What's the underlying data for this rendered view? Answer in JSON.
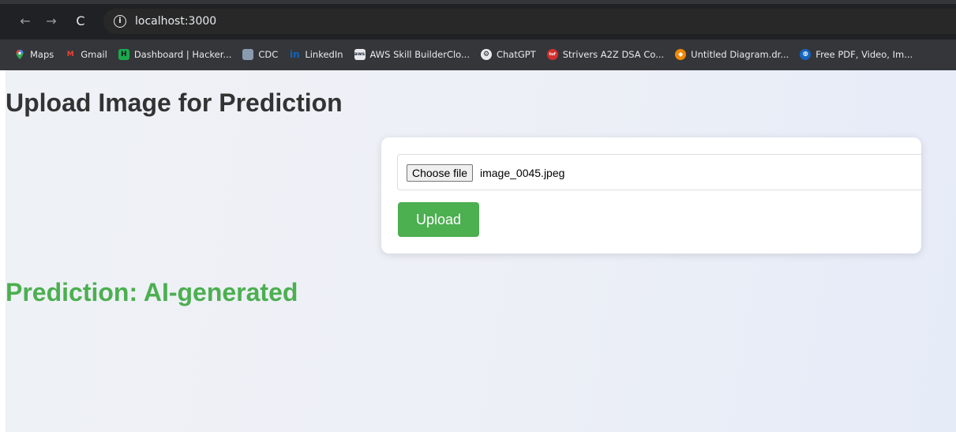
{
  "browser": {
    "nav": {
      "back_icon": "←",
      "forward_icon": "→",
      "reload_icon": "C",
      "info_icon": "i"
    },
    "url": "localhost:3000",
    "bookmarks": [
      {
        "label": "Maps",
        "icon": "maps-icon",
        "color": "#ea4335",
        "glyph": ""
      },
      {
        "label": "Gmail",
        "icon": "gmail-icon",
        "color": "#ea4335",
        "glyph": "M"
      },
      {
        "label": "Dashboard | Hacker...",
        "icon": "hackerrank-icon",
        "color": "#1ba94c",
        "glyph": "H"
      },
      {
        "label": "CDC",
        "icon": "cdc-icon",
        "color": "#8a9bb0",
        "glyph": ""
      },
      {
        "label": "LinkedIn",
        "icon": "linkedin-icon",
        "color": "#0a66c2",
        "glyph": "in"
      },
      {
        "label": "AWS Skill BuilderClo...",
        "icon": "aws-icon",
        "color": "#232f3e",
        "glyph": "aws"
      },
      {
        "label": "ChatGPT",
        "icon": "chatgpt-icon",
        "color": "#555555",
        "glyph": "⚙"
      },
      {
        "label": "Strivers A2Z DSA Co...",
        "icon": "takeuforward-icon",
        "color": "#d32f2f",
        "glyph": "tuf"
      },
      {
        "label": "Untitled Diagram.dr...",
        "icon": "drawio-icon",
        "color": "#f08705",
        "glyph": "◆"
      },
      {
        "label": "Free PDF, Video, Im...",
        "icon": "converter-icon",
        "color": "#1565c0",
        "glyph": "⊕"
      }
    ]
  },
  "page": {
    "title": "Upload Image for Prediction",
    "form": {
      "choose_file_label": "Choose file",
      "file_name": "image_0045.jpeg",
      "upload_label": "Upload"
    },
    "prediction": "Prediction: AI-generated"
  },
  "colors": {
    "accent": "#4caf50",
    "heading": "#333333"
  }
}
